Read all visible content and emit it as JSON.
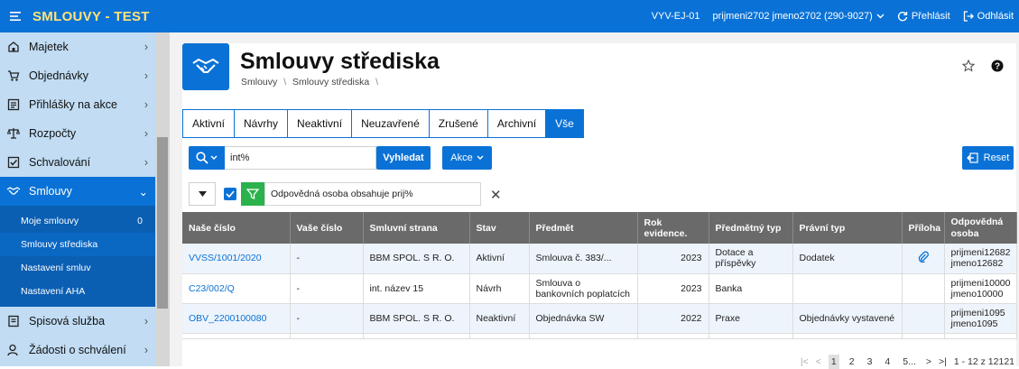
{
  "app": {
    "title": "SMLOUVY - TEST"
  },
  "topbar": {
    "env": "VYV-EJ-01",
    "user": "prijmeni2702 jmeno2702 (290-9027)",
    "switch_label": "Přehlásit",
    "logout_label": "Odhlásit"
  },
  "sidebar": {
    "items": [
      {
        "label": "Majetek",
        "icon": "house-icon"
      },
      {
        "label": "Objednávky",
        "icon": "cart-icon"
      },
      {
        "label": "Přihlášky na akce",
        "icon": "list-icon"
      },
      {
        "label": "Rozpočty",
        "icon": "scale-icon"
      },
      {
        "label": "Schvalování",
        "icon": "checkbox-icon"
      },
      {
        "label": "Smlouvy",
        "icon": "handshake-icon"
      },
      {
        "label": "Spisová služba",
        "icon": "document-icon"
      },
      {
        "label": "Žádosti o schválení",
        "icon": "person-icon"
      }
    ],
    "subitems": [
      {
        "label": "Moje smlouvy",
        "count": "0"
      },
      {
        "label": "Smlouvy střediska",
        "count": ""
      },
      {
        "label": "Nastavení smluv",
        "count": ""
      },
      {
        "label": "Nastavení AHA",
        "count": ""
      }
    ]
  },
  "page": {
    "title": "Smlouvy střediska",
    "breadcrumb_1": "Smlouvy",
    "breadcrumb_2": "Smlouvy střediska",
    "sep": "\\"
  },
  "tabs": [
    "Aktivní",
    "Návrhy",
    "Neaktivní",
    "Neuzavřené",
    "Zrušené",
    "Archivní",
    "Vše"
  ],
  "active_tab": "Vše",
  "search": {
    "value": "int%",
    "button": "Vyhledat"
  },
  "actions_label": "Akce",
  "reset_label": "Reset",
  "filter": {
    "text": "Odpovědná osoba obsahuje prij%",
    "close": "✕"
  },
  "table": {
    "columns": [
      "Naše číslo",
      "Vaše číslo",
      "Smluvní strana",
      "Stav",
      "Předmět",
      "Rok evidence.",
      "Předmětný typ",
      "Právní typ",
      "Příloha",
      "Odpovědná osoba"
    ],
    "rows": [
      {
        "nase": "VVSS/1001/2020",
        "vase": "-",
        "strana": "BBM SPOL. S R. O.",
        "stav": "Aktivní",
        "predmet": "Smlouva č. 383/...",
        "rok": "2023",
        "ptyp": "Dotace a příspěvky",
        "prtyp": "Dodatek",
        "priloha": true,
        "osoba1": "prijmeni12682",
        "osoba2": "jmeno12682"
      },
      {
        "nase": "C23/002/Q",
        "vase": "-",
        "strana": "int. název 15",
        "stav": "Návrh",
        "predmet": "Smlouva o bankovních poplatcích",
        "rok": "2023",
        "ptyp": "Banka",
        "prtyp": "",
        "priloha": false,
        "osoba1": "prijmeni10000",
        "osoba2": "jmeno10000"
      },
      {
        "nase": "OBV_2200100080",
        "vase": "-",
        "strana": "BBM SPOL. S R. O.",
        "stav": "Neaktivní",
        "predmet": "Objednávka SW",
        "rok": "2022",
        "ptyp": "Praxe",
        "prtyp": "Objednávky vystavené",
        "priloha": false,
        "osoba1": "prijmeni1095",
        "osoba2": "jmeno1095"
      }
    ]
  },
  "pager": {
    "pages": [
      "1",
      "2",
      "3",
      "4",
      "5..."
    ],
    "current": "1",
    "summary": "1 - 12 z 12121"
  },
  "colors": {
    "primary": "#0a72d6",
    "title_accent": "#ffe27a",
    "sidebar_bg": "#c1dcf3",
    "filter_green": "#2bb24c"
  }
}
